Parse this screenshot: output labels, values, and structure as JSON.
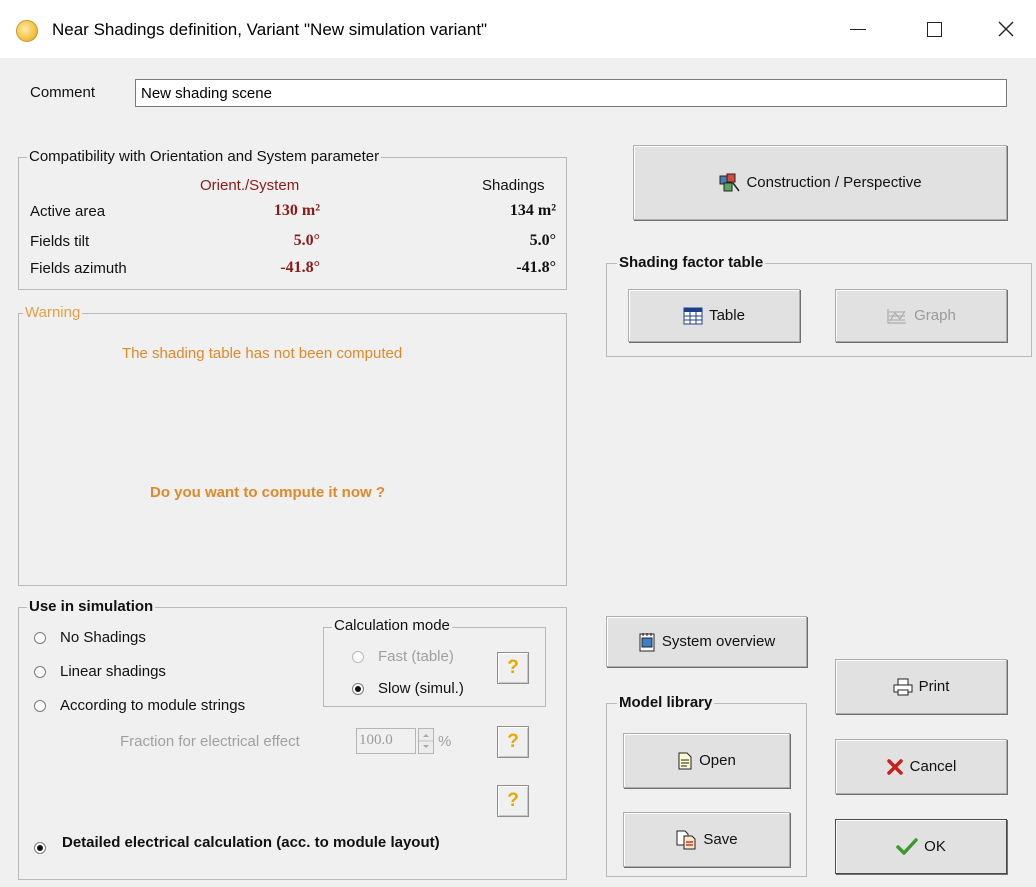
{
  "window": {
    "title": "Near Shadings definition, Variant \"New simulation variant\"",
    "minimize_glyph": "—",
    "maximize_glyph": "□",
    "close_glyph": "✕"
  },
  "comment": {
    "label": "Comment",
    "value": "New shading scene"
  },
  "compatibility": {
    "legend": "Compatibility with Orientation and System parameter",
    "col_orient": "Orient./System",
    "col_shadings": "Shadings",
    "rows": [
      {
        "label": "Active area",
        "orient": "130 m²",
        "shadings": "134 m²"
      },
      {
        "label": "Fields tilt",
        "orient": "5.0°",
        "shadings": "5.0°"
      },
      {
        "label": "Fields azimuth",
        "orient": "-41.8°",
        "shadings": "-41.8°"
      }
    ]
  },
  "warning": {
    "legend": "Warning",
    "message": "The shading table has not been computed",
    "question": "Do you want to compute it now ?"
  },
  "use_in_simulation": {
    "legend": "Use in simulation",
    "options": [
      "No Shadings",
      "Linear shadings",
      "According to module strings"
    ],
    "fraction_label": "Fraction for electrical effect",
    "fraction_value": "100.0",
    "fraction_unit": "%",
    "detailed_label": "Detailed electrical calculation (acc. to module layout)",
    "help_glyph": "?"
  },
  "calculation_mode": {
    "legend": "Calculation mode",
    "fast": "Fast (table)",
    "slow": "Slow (simul.)"
  },
  "buttons": {
    "construction": "Construction / Perspective",
    "table": "Table",
    "graph": "Graph",
    "system_overview": "System overview",
    "print": "Print",
    "open": "Open",
    "save": "Save",
    "cancel": "Cancel",
    "ok": "OK"
  },
  "shading_factor_table": {
    "legend": "Shading factor table"
  },
  "model_library": {
    "legend": "Model library"
  },
  "colors": {
    "accent_red": "#8b1a1a",
    "warning_orange": "#e0892a",
    "help_yellow": "#e7a800"
  }
}
